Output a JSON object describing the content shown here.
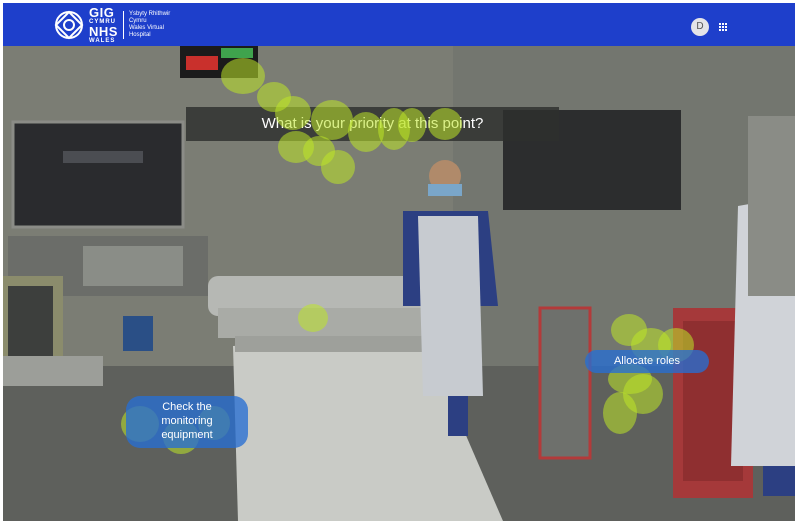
{
  "header": {
    "logo": {
      "letters_top": "GIG",
      "letters_top_sub": "CYMRU",
      "letters_bottom": "NHS",
      "letters_bottom_sub": "WALES",
      "text_lines": [
        "Ysbyty Rhithwir",
        "Cymru",
        "Wales Virtual",
        "Hospital"
      ]
    },
    "avatar_initial": "D",
    "apps_icon": "apps-grid-icon"
  },
  "scene": {
    "question": "What is your priority at this point?",
    "choices": [
      {
        "label": "Allocate roles"
      },
      {
        "label": "Check the monitoring equipment",
        "lines": [
          "Check the",
          "monitoring",
          "equipment"
        ]
      }
    ]
  },
  "colors": {
    "header": "#1e3fcb",
    "choice_bubble": "#286ed2",
    "heatmap": "#bee628",
    "banner": "#2d2f2d"
  }
}
